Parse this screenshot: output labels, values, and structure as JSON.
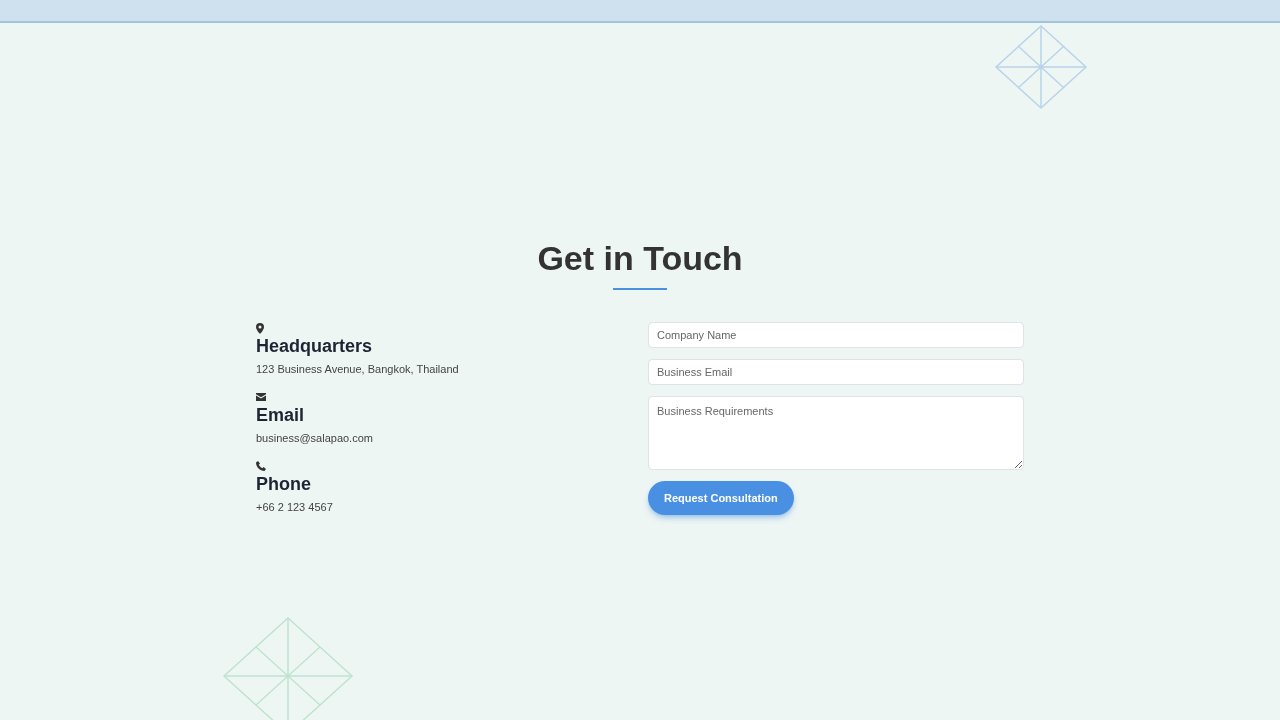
{
  "heading": "Get in Touch",
  "contacts": [
    {
      "kind": "location",
      "title": "Headquarters",
      "detail": "123 Business Avenue, Bangkok, Thailand"
    },
    {
      "kind": "email",
      "title": "Email",
      "detail": "business@salapao.com"
    },
    {
      "kind": "phone",
      "title": "Phone",
      "detail": "+66 2 123 4567"
    }
  ],
  "form": {
    "fields": [
      {
        "kind": "input",
        "placeholder": "Company Name"
      },
      {
        "kind": "input",
        "placeholder": "Business Email"
      },
      {
        "kind": "textarea",
        "placeholder": "Business Requirements"
      }
    ],
    "submit": "Request Consultation"
  }
}
